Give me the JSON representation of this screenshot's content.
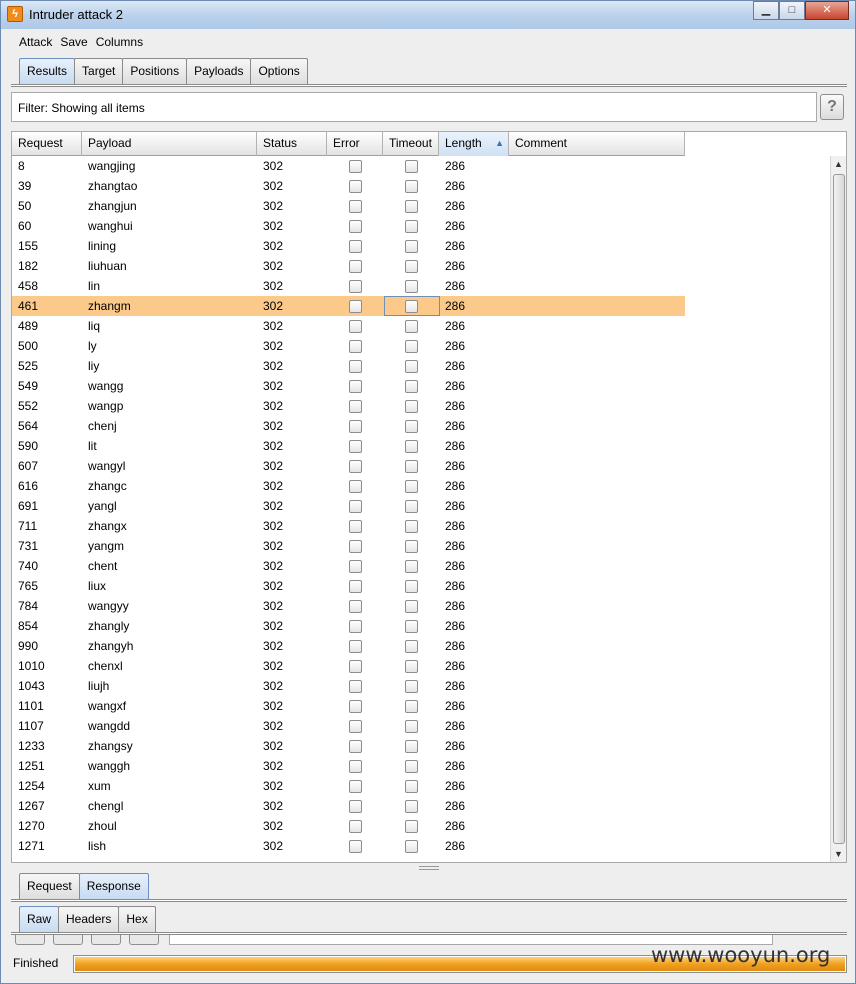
{
  "window": {
    "title": "Intruder attack 2"
  },
  "menu": [
    "Attack",
    "Save",
    "Columns"
  ],
  "main_tabs": [
    "Results",
    "Target",
    "Positions",
    "Payloads",
    "Options"
  ],
  "filter": {
    "text": "Filter: Showing all items",
    "help": "?"
  },
  "columns": [
    "Request",
    "Payload",
    "Status",
    "Error",
    "Timeout",
    "Length",
    "Comment"
  ],
  "sorted_column": "Length",
  "rows": [
    {
      "request": "8",
      "payload": "wangjing",
      "status": "302",
      "length": "286"
    },
    {
      "request": "39",
      "payload": "zhangtao",
      "status": "302",
      "length": "286"
    },
    {
      "request": "50",
      "payload": "zhangjun",
      "status": "302",
      "length": "286"
    },
    {
      "request": "60",
      "payload": "wanghui",
      "status": "302",
      "length": "286"
    },
    {
      "request": "155",
      "payload": "lining",
      "status": "302",
      "length": "286"
    },
    {
      "request": "182",
      "payload": "liuhuan",
      "status": "302",
      "length": "286"
    },
    {
      "request": "458",
      "payload": "lin",
      "status": "302",
      "length": "286"
    },
    {
      "request": "461",
      "payload": "zhangm",
      "status": "302",
      "length": "286",
      "selected": true
    },
    {
      "request": "489",
      "payload": "liq",
      "status": "302",
      "length": "286"
    },
    {
      "request": "500",
      "payload": "ly",
      "status": "302",
      "length": "286"
    },
    {
      "request": "525",
      "payload": "liy",
      "status": "302",
      "length": "286"
    },
    {
      "request": "549",
      "payload": "wangg",
      "status": "302",
      "length": "286"
    },
    {
      "request": "552",
      "payload": "wangp",
      "status": "302",
      "length": "286"
    },
    {
      "request": "564",
      "payload": "chenj",
      "status": "302",
      "length": "286"
    },
    {
      "request": "590",
      "payload": "lit",
      "status": "302",
      "length": "286"
    },
    {
      "request": "607",
      "payload": "wangyl",
      "status": "302",
      "length": "286"
    },
    {
      "request": "616",
      "payload": "zhangc",
      "status": "302",
      "length": "286"
    },
    {
      "request": "691",
      "payload": "yangl",
      "status": "302",
      "length": "286"
    },
    {
      "request": "711",
      "payload": "zhangx",
      "status": "302",
      "length": "286"
    },
    {
      "request": "731",
      "payload": "yangm",
      "status": "302",
      "length": "286"
    },
    {
      "request": "740",
      "payload": "chent",
      "status": "302",
      "length": "286"
    },
    {
      "request": "765",
      "payload": "liux",
      "status": "302",
      "length": "286"
    },
    {
      "request": "784",
      "payload": "wangyy",
      "status": "302",
      "length": "286"
    },
    {
      "request": "854",
      "payload": "zhangly",
      "status": "302",
      "length": "286"
    },
    {
      "request": "990",
      "payload": "zhangyh",
      "status": "302",
      "length": "286"
    },
    {
      "request": "1010",
      "payload": "chenxl",
      "status": "302",
      "length": "286"
    },
    {
      "request": "1043",
      "payload": "liujh",
      "status": "302",
      "length": "286"
    },
    {
      "request": "1101",
      "payload": "wangxf",
      "status": "302",
      "length": "286"
    },
    {
      "request": "1107",
      "payload": "wangdd",
      "status": "302",
      "length": "286"
    },
    {
      "request": "1233",
      "payload": "zhangsy",
      "status": "302",
      "length": "286"
    },
    {
      "request": "1251",
      "payload": "wanggh",
      "status": "302",
      "length": "286"
    },
    {
      "request": "1254",
      "payload": "xum",
      "status": "302",
      "length": "286"
    },
    {
      "request": "1267",
      "payload": "chengl",
      "status": "302",
      "length": "286"
    },
    {
      "request": "1270",
      "payload": "zhoul",
      "status": "302",
      "length": "286"
    },
    {
      "request": "1271",
      "payload": "lish",
      "status": "302",
      "length": "286"
    }
  ],
  "detail_tabs": [
    "Request",
    "Response"
  ],
  "view_tabs": [
    "Raw",
    "Headers",
    "Hex"
  ],
  "status": {
    "text": "Finished",
    "progress": 1.0
  },
  "watermark": "www.wooyun.org",
  "colors": {
    "selected_row": "#fbc98a",
    "progress": "#f0a020",
    "active_tab": "#c7dbf2"
  },
  "icons": {
    "title": "burp-lightning-icon",
    "help": "help-icon",
    "sort": "sort-ascending-icon"
  }
}
